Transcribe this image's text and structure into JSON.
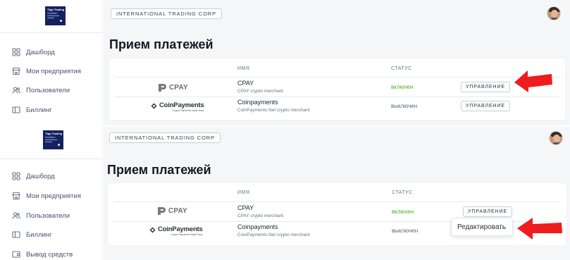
{
  "company": "INTERNATIONAL TRADING CORP",
  "page_title": "Прием платежей",
  "logo": {
    "line1": "Ttpp Trading",
    "line2": "Solution"
  },
  "nav": [
    {
      "label": "Дашборд",
      "icon": "dashboard-icon"
    },
    {
      "label": "Мои предприятия",
      "icon": "store-icon"
    },
    {
      "label": "Пользователи",
      "icon": "users-icon"
    },
    {
      "label": "Биллинг",
      "icon": "billing-icon"
    },
    {
      "label": "Вывод средств",
      "icon": "wallet-icon"
    }
  ],
  "table": {
    "headers": {
      "name": "ИМЯ",
      "status": "СТАТУС"
    },
    "rows": [
      {
        "logo": "CPAY",
        "name": "CPAY",
        "desc": "CPAY crypto merchant",
        "status": "включен",
        "action": "УПРАВЛЕНИЕ"
      },
      {
        "logo": "CoinPayments",
        "logo_sub": "Crypto Payments Made Easy",
        "name": "Coinpayments",
        "desc": "CoinPayments.Net crypto merchant",
        "status": "выключен",
        "action": "УПРАВЛЕНИЕ"
      }
    ]
  },
  "dropdown": {
    "edit_label": "Редактировать"
  },
  "colors": {
    "enabled": "#4caf1a",
    "disabled": "#5c6478",
    "arrow": "#ee1c1c",
    "logo_bg": "#14215e"
  }
}
